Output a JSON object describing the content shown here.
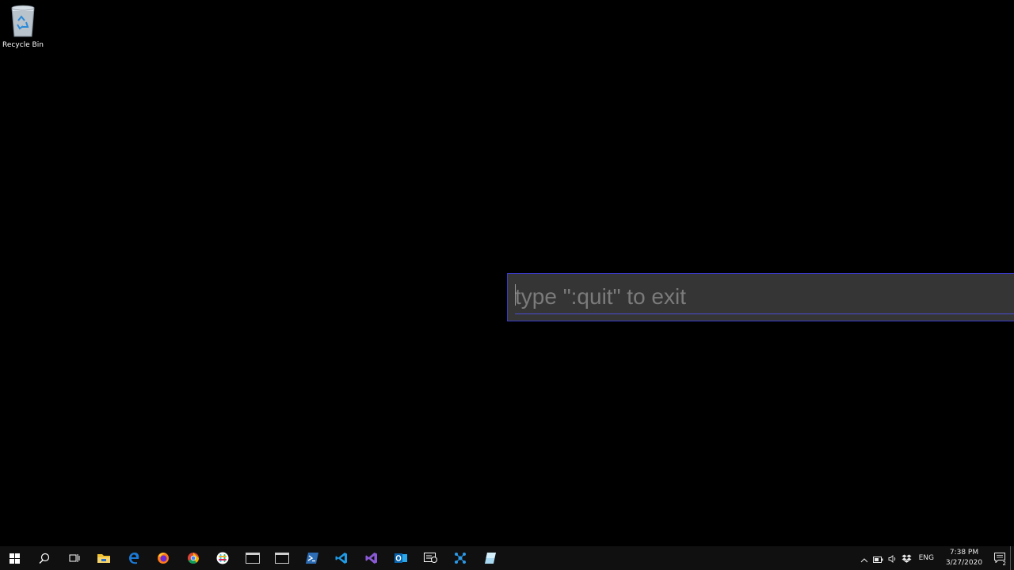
{
  "desktop": {
    "recycle_bin_label": "Recycle Bin"
  },
  "input_bar": {
    "placeholder": "type \":quit\" to exit",
    "value": "",
    "border_color": "#3b3bc8",
    "background": "#353535"
  },
  "taskbar": {
    "pinned": [
      {
        "name": "start-button",
        "icon": "windows-logo-icon"
      },
      {
        "name": "search-button",
        "icon": "search-icon"
      },
      {
        "name": "task-view-button",
        "icon": "task-view-icon"
      },
      {
        "name": "file-explorer-button",
        "icon": "folder-icon"
      },
      {
        "name": "edge-button",
        "icon": "edge-icon"
      },
      {
        "name": "firefox-button",
        "icon": "firefox-icon"
      },
      {
        "name": "chrome-button",
        "icon": "chrome-icon"
      },
      {
        "name": "slack-button",
        "icon": "slack-icon"
      },
      {
        "name": "terminal-button",
        "icon": "terminal-icon"
      },
      {
        "name": "terminal-2-button",
        "icon": "terminal-icon"
      },
      {
        "name": "powershell-button",
        "icon": "powershell-icon"
      },
      {
        "name": "vscode-button",
        "icon": "vscode-icon"
      },
      {
        "name": "visual-studio-button",
        "icon": "visual-studio-icon"
      },
      {
        "name": "outlook-button",
        "icon": "outlook-icon"
      },
      {
        "name": "notes-button",
        "icon": "notes-icon"
      },
      {
        "name": "network-app-button",
        "icon": "network-icon"
      },
      {
        "name": "app-button",
        "icon": "app-icon"
      }
    ],
    "tray": {
      "language": "ENG",
      "time": "7:38 PM",
      "date": "3/27/2020",
      "notification_count": "2"
    }
  }
}
